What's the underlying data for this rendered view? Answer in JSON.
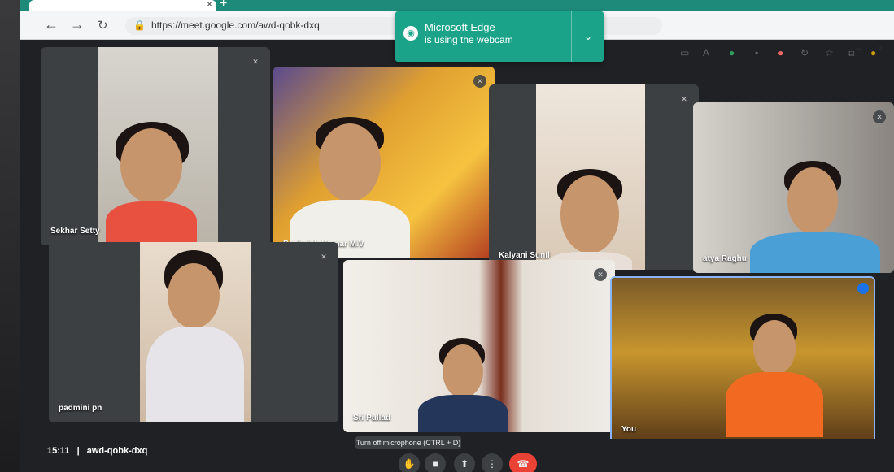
{
  "browser": {
    "url": "https://meet.google.com/awd-qobk-dxq",
    "notification_title": "Microsoft Edge",
    "notification_sub": "is using the webcam"
  },
  "participants": [
    {
      "name": "Sekhar Setty"
    },
    {
      "name": "Bashaiah Kumar M.V"
    },
    {
      "name": "Kalyani Sunil"
    },
    {
      "name": "atya Raghu"
    },
    {
      "name": "padmini pn"
    },
    {
      "name": "Sri Pullad"
    },
    {
      "name": "You"
    }
  ],
  "footer": {
    "time": "15:11",
    "separator": "|",
    "meeting_code": "awd-qobk-dxq",
    "tooltip": "Turn off microphone (CTRL + D)"
  },
  "icons": [
    "back-arrow-icon",
    "forward-arrow-icon",
    "reload-icon",
    "lock-icon",
    "webcam-icon",
    "chevron-down-icon",
    "mic-off-icon",
    "more-options-icon",
    "raise-hand-icon",
    "camera-icon",
    "present-icon",
    "end-call-icon"
  ],
  "colors": {
    "notification": "#1aa388",
    "end_call": "#ea4335",
    "self_border": "#8ab4f8"
  }
}
